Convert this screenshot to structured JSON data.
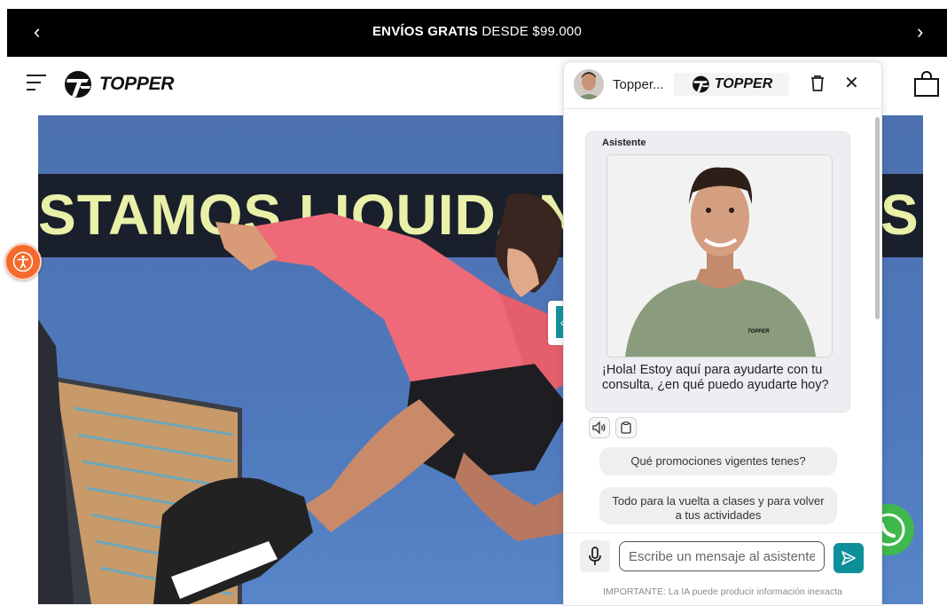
{
  "promo_bar": {
    "bold_text": "ENVÍOS GRATIS",
    "text": " DESDE $99.000",
    "prev": "‹",
    "next": "›"
  },
  "header": {
    "logo_text": "TOPPER"
  },
  "hero": {
    "banner_left": "STAMOS LIQUIDAND",
    "banner_right": "S"
  },
  "chat": {
    "header": {
      "title": "Topper...",
      "logo_text": "TOPPER",
      "close": "✕"
    },
    "message": {
      "sender": "Asistente",
      "text": "¡Hola! Estoy aquí para ayudarte con tu consulta, ¿en qué puedo ayudarte hoy?",
      "shirt_logo": "TOPPER"
    },
    "suggestions": [
      "Qué promociones vigentes tenes?",
      "Todo para la vuelta a clases y para volver a tus actividades"
    ],
    "input_placeholder": "Escribe un mensaje al asistente",
    "disclaimer": "IMPORTANTE: La IA puede producir información inexacta",
    "collapse_label": "«"
  },
  "colors": {
    "promo_bg": "#000000",
    "banner_text": "#e9f0a8",
    "accent": "#0d8f9a",
    "accessibility": "#f46a2c",
    "whatsapp": "#3fb84c"
  },
  "icons": [
    "chevron-left-icon",
    "chevron-right-icon",
    "menu-icon",
    "topper-logo",
    "shopping-bag-icon",
    "accessibility-icon",
    "trash-icon",
    "close-icon",
    "speaker-icon",
    "clipboard-icon",
    "microphone-icon",
    "send-icon",
    "whatsapp-icon",
    "double-chevron-left-icon"
  ]
}
